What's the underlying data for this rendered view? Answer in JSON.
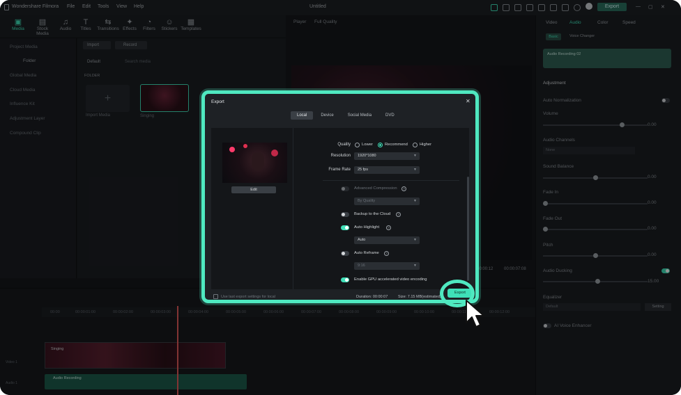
{
  "app": {
    "name": "Wondershare Filmora",
    "menus": [
      "File",
      "Edit",
      "Tools",
      "View",
      "Help"
    ],
    "doc_title": "Untitled",
    "export_label": "Export"
  },
  "toolbar": {
    "items": [
      {
        "label": "Media",
        "icon": "media-icon"
      },
      {
        "label": "Stock Media",
        "icon": "stock-media-icon"
      },
      {
        "label": "Audio",
        "icon": "audio-icon"
      },
      {
        "label": "Titles",
        "icon": "titles-icon"
      },
      {
        "label": "Transitions",
        "icon": "transitions-icon"
      },
      {
        "label": "Effects",
        "icon": "effects-icon"
      },
      {
        "label": "Filters",
        "icon": "filters-icon"
      },
      {
        "label": "Stickers",
        "icon": "stickers-icon"
      },
      {
        "label": "Templates",
        "icon": "templates-icon"
      }
    ]
  },
  "sidebar": {
    "items": [
      "Project Media",
      "Folder",
      "Global Media",
      "Cloud Media",
      "Influence Kit",
      "Adjustment Layer",
      "Compound Clip"
    ]
  },
  "media": {
    "import": "Import",
    "record": "Record",
    "default": "Default",
    "search": "Search media",
    "folder": "FOLDER",
    "import_media": "Import Media",
    "clip_name": "Singing"
  },
  "player": {
    "label": "Player",
    "quality": "Full Quality",
    "time_a": "00:00:12",
    "time_b": "00:00:07:08"
  },
  "props": {
    "tabs": [
      "Video",
      "Audio",
      "Color",
      "Speed"
    ],
    "subtabs": [
      "Basic",
      "Voice Changer"
    ],
    "clip": "Audio Recording 02",
    "section": "Adjustment",
    "rows": [
      {
        "label": "Auto Normalization"
      },
      {
        "label": "Volume",
        "value": "0.00",
        "unit": "dB"
      },
      {
        "label": "Audio Channels",
        "value": "None"
      },
      {
        "label": "Sound Balance",
        "left": "L",
        "right": "R",
        "value": "0.00"
      },
      {
        "label": "Fade In",
        "value": "0.00",
        "unit": "s"
      },
      {
        "label": "Fade Out",
        "value": "0.00",
        "unit": "s"
      },
      {
        "label": "Pitch",
        "value": "0.00"
      },
      {
        "label": "Audio Ducking",
        "value": "15.00",
        "unit": "%"
      },
      {
        "label": "Equalizer",
        "value": "Default",
        "button": "Setting"
      },
      {
        "label": "AI Voice Enhancer"
      }
    ]
  },
  "timeline": {
    "ticks": [
      "00:00",
      "00:00:01:00",
      "00:00:02:00",
      "00:00:03:00",
      "00:00:04:00",
      "00:00:05:00",
      "00:00:06:00",
      "00:00:07:00",
      "00:00:08:00",
      "00:00:09:00",
      "00:00:10:00",
      "00:00:11:00",
      "00:00:12:00"
    ],
    "video_track": "Video 1",
    "audio_track": "Audio 1",
    "audio_clip": "Audio Recording",
    "video_clip": "Singing"
  },
  "export": {
    "title": "Export",
    "tabs": [
      "Local",
      "Device",
      "Social Media",
      "DVD"
    ],
    "edit": "Edit",
    "quality_label": "Quality",
    "quality_options": [
      "Lower",
      "Recommend",
      "Higher"
    ],
    "resolution_label": "Resolution",
    "resolution": "1920*1080",
    "frame_rate_label": "Frame Rate",
    "frame_rate": "25 fps",
    "advanced_compression": "Advanced Compression",
    "by_quality": "By Quality",
    "backup": "Backup to the Cloud",
    "auto_highlight": "Auto Highlight",
    "auto_highlight_value": "Auto",
    "auto_reframe": "Auto Reframe",
    "reframe_value": "9:16",
    "gpu": "Enable GPU accelerated video encoding",
    "last_settings": "Use last export settings for local",
    "duration": "Duration: 00:00:07",
    "size": "Size: 7.15 MB(estimated)",
    "button": "Export",
    "close": "✕"
  },
  "colors": {
    "accent": "#3fe0b8",
    "highlight": "#4fe8c0"
  }
}
